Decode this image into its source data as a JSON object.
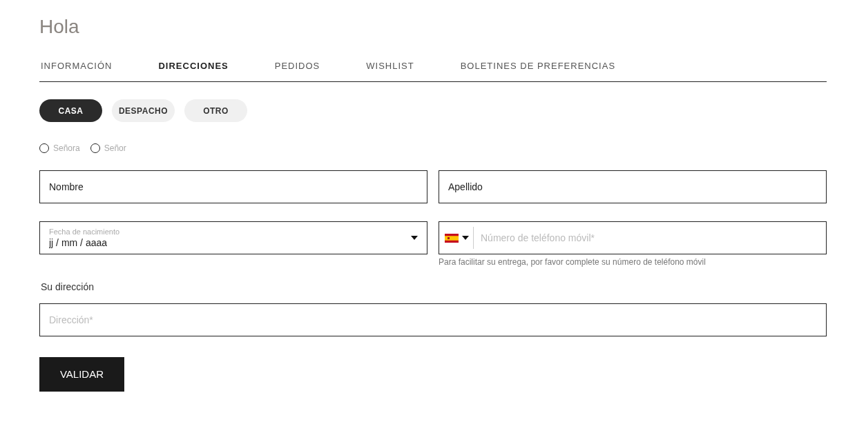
{
  "greeting": "Hola",
  "tabs": [
    {
      "label": "INFORMACIÓN",
      "selected": false
    },
    {
      "label": "DIRECCIONES",
      "selected": true
    },
    {
      "label": "PEDIDOS",
      "selected": false
    },
    {
      "label": "WISHLIST",
      "selected": false
    },
    {
      "label": "BOLETINES DE PREFERENCIAS",
      "selected": false
    }
  ],
  "address_types": [
    {
      "label": "CASA",
      "selected": true
    },
    {
      "label": "DESPACHO",
      "selected": false
    },
    {
      "label": "OTRO",
      "selected": false
    }
  ],
  "salutations": [
    {
      "label": "Señora",
      "checked": false
    },
    {
      "label": "Señor",
      "checked": false
    }
  ],
  "first_name": {
    "placeholder": "Nombre"
  },
  "last_name": {
    "placeholder": "Apellido"
  },
  "birth_date": {
    "label": "Fecha de nacimiento",
    "placeholder": "jj / mm / aaaa"
  },
  "phone": {
    "placeholder": "Número de teléfono móvil*",
    "hint": "Para facilitar su entrega, por favor complete su número de teléfono móvil"
  },
  "address_section": {
    "title": "Su dirección",
    "placeholder": "Dirección*"
  },
  "submit": "VALIDAR"
}
